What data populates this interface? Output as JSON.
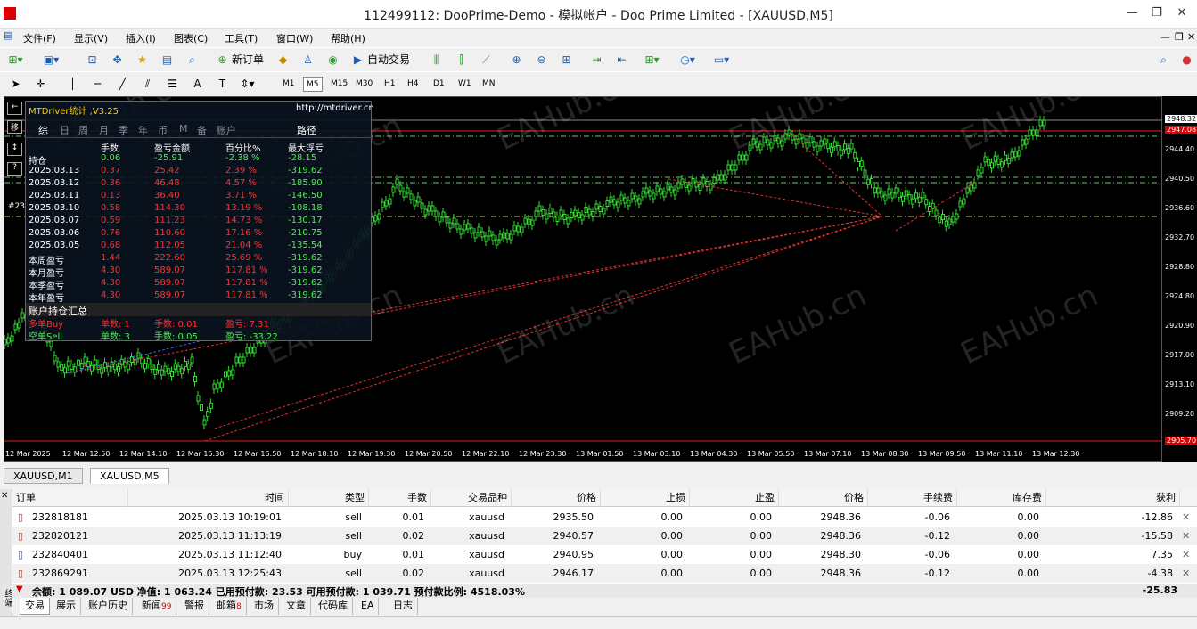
{
  "window": {
    "title": "112499112: DooPrime-Demo - 模拟帐户 - Doo Prime Limited - [XAUUSD,M5]"
  },
  "menu": [
    "文件(F)",
    "显示(V)",
    "插入(I)",
    "图表(C)",
    "工具(T)",
    "窗口(W)",
    "帮助(H)"
  ],
  "toolbar": {
    "new_order": "新订单",
    "auto_trade": "自动交易",
    "timeframes": [
      "M1",
      "M5",
      "M15",
      "M30",
      "H1",
      "H4",
      "D1",
      "W1",
      "MN"
    ]
  },
  "chart": {
    "price_ticks": [
      "2948.32",
      "2947.08",
      "2944.40",
      "2940.50",
      "2936.60",
      "2932.70",
      "2928.80",
      "2924.80",
      "2920.90",
      "2917.00",
      "2913.10",
      "2909.20",
      "2905.70"
    ],
    "time_ticks": [
      "12 Mar 2025",
      "12 Mar 12:50",
      "12 Mar 14:10",
      "12 Mar 15:30",
      "12 Mar 16:50",
      "12 Mar 18:10",
      "12 Mar 19:30",
      "12 Mar 20:50",
      "12 Mar 22:10",
      "12 Mar 23:30",
      "13 Mar 01:50",
      "13 Mar 03:10",
      "13 Mar 04:30",
      "13 Mar 05:50",
      "13 Mar 07:10",
      "13 Mar 08:30",
      "13 Mar 09:50",
      "13 Mar 11:10",
      "13 Mar 12:30"
    ],
    "left_label": "#23",
    "watermark": "EAHub.cn"
  },
  "panel": {
    "title": "MTDriver统计 ,V3.25",
    "url": "http://mtdriver.cn",
    "tabs": [
      "综",
      "日",
      "周",
      "月",
      "季",
      "年",
      "币",
      "M",
      "备",
      "账户"
    ],
    "path_label": "路径",
    "headers": [
      "手数",
      "盈亏金额",
      "百分比%",
      "最大浮亏"
    ],
    "rows": [
      {
        "label": "持仓",
        "lots": "0.06",
        "pnl": "-25.91",
        "pct": "-2.38 %",
        "maxdd": "-28.15",
        "color": "#4df04d"
      },
      {
        "label": "2025.03.13",
        "lots": "0.37",
        "pnl": "25.42",
        "pct": "2.39 %",
        "maxdd": "-319.62",
        "color": "#ff3030"
      },
      {
        "label": "2025.03.12",
        "lots": "0.36",
        "pnl": "46.48",
        "pct": "4.57 %",
        "maxdd": "-185.90",
        "color": "#ff3030"
      },
      {
        "label": "2025.03.11",
        "lots": "0.13",
        "pnl": "36.40",
        "pct": "3.71 %",
        "maxdd": "-146.50",
        "color": "#ff3030"
      },
      {
        "label": "2025.03.10",
        "lots": "0.58",
        "pnl": "114.30",
        "pct": "13.19 %",
        "maxdd": "-108.18",
        "color": "#ff3030"
      },
      {
        "label": "2025.03.07",
        "lots": "0.59",
        "pnl": "111.23",
        "pct": "14.73 %",
        "maxdd": "-130.17",
        "color": "#ff3030"
      },
      {
        "label": "2025.03.06",
        "lots": "0.76",
        "pnl": "110.60",
        "pct": "17.16 %",
        "maxdd": "-210.75",
        "color": "#ff3030"
      },
      {
        "label": "2025.03.05",
        "lots": "0.68",
        "pnl": "112.05",
        "pct": "21.04 %",
        "maxdd": "-135.54",
        "color": "#ff3030"
      },
      {
        "label": "本周盈亏",
        "lots": "1.44",
        "pnl": "222.60",
        "pct": "25.69 %",
        "maxdd": "-319.62",
        "color": "#ff3030"
      },
      {
        "label": "本月盈亏",
        "lots": "4.30",
        "pnl": "589.07",
        "pct": "117.81 %",
        "maxdd": "-319.62",
        "color": "#ff3030"
      },
      {
        "label": "本季盈亏",
        "lots": "4.30",
        "pnl": "589.07",
        "pct": "117.81 %",
        "maxdd": "-319.62",
        "color": "#ff3030"
      },
      {
        "label": "本年盈亏",
        "lots": "4.30",
        "pnl": "589.07",
        "pct": "117.81 %",
        "maxdd": "-319.62",
        "color": "#ff3030"
      }
    ],
    "summary_title": "账户持仓汇总",
    "buy": {
      "label": "多单Buy",
      "orders": "单数: 1",
      "lots": "手数: 0.01",
      "pnl": "盈亏: 7.31"
    },
    "sell": {
      "label": "空单Sell",
      "orders": "单数: 3",
      "lots": "手数: 0.05",
      "pnl": "盈亏: -33.22"
    }
  },
  "chart_tabs": [
    "XAUUSD,M1",
    "XAUUSD,M5"
  ],
  "orders": {
    "headers": [
      "订单",
      "时间",
      "类型",
      "手数",
      "交易品种",
      "价格",
      "止损",
      "止盈",
      "价格",
      "手续费",
      "库存费",
      "获利"
    ],
    "rows": [
      [
        "232818181",
        "2025.03.13 10:19:01",
        "sell",
        "0.01",
        "xauusd",
        "2935.50",
        "0.00",
        "0.00",
        "2948.36",
        "-0.06",
        "0.00",
        "-12.86"
      ],
      [
        "232820121",
        "2025.03.13 11:13:19",
        "sell",
        "0.02",
        "xauusd",
        "2940.57",
        "0.00",
        "0.00",
        "2948.36",
        "-0.12",
        "0.00",
        "-15.58"
      ],
      [
        "232840401",
        "2025.03.13 11:12:40",
        "buy",
        "0.01",
        "xauusd",
        "2940.95",
        "0.00",
        "0.00",
        "2948.30",
        "-0.06",
        "0.00",
        "7.35"
      ],
      [
        "232869291",
        "2025.03.13 12:25:43",
        "sell",
        "0.02",
        "xauusd",
        "2946.17",
        "0.00",
        "0.00",
        "2948.36",
        "-0.12",
        "0.00",
        "-4.38"
      ]
    ],
    "summary": "余额: 1 089.07 USD  净值: 1 063.24  已用预付款: 23.53  可用预付款: 1 039.71  预付款比例: 4518.03%",
    "summary_total": "-25.83"
  },
  "bottom_tabs": [
    {
      "label": "交易",
      "badge": ""
    },
    {
      "label": "展示",
      "badge": ""
    },
    {
      "label": "账户历史",
      "badge": ""
    },
    {
      "label": "新闻",
      "badge": "99"
    },
    {
      "label": "警报",
      "badge": ""
    },
    {
      "label": "邮箱",
      "badge": "8"
    },
    {
      "label": "市场",
      "badge": ""
    },
    {
      "label": "文章",
      "badge": ""
    },
    {
      "label": "代码库",
      "badge": ""
    },
    {
      "label": "EA",
      "badge": ""
    },
    {
      "label": "日志",
      "badge": ""
    }
  ],
  "side_label": "终端"
}
